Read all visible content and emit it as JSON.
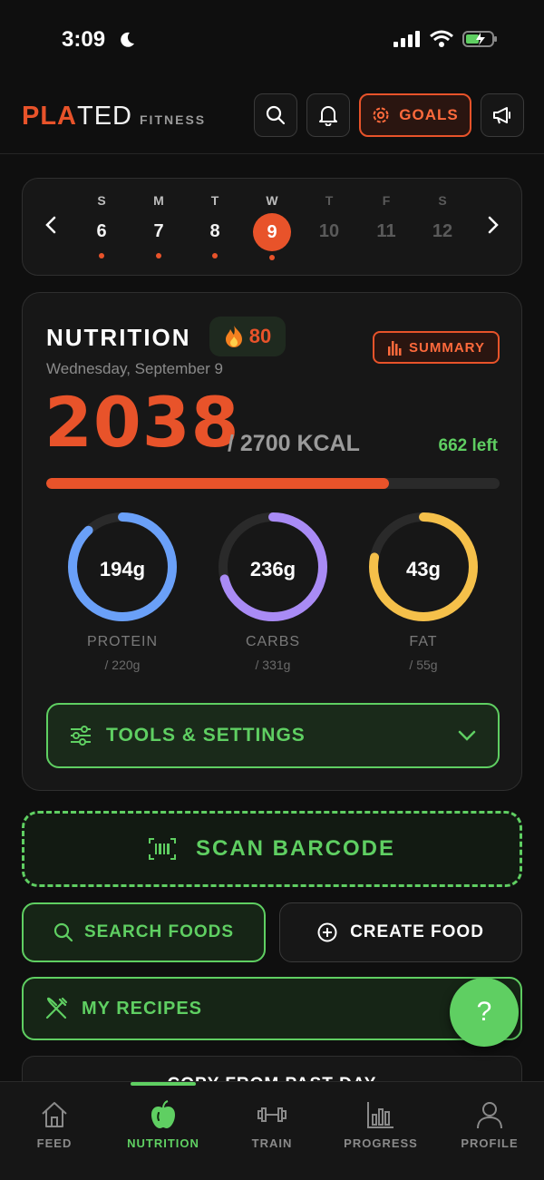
{
  "status_bar": {
    "time": "3:09"
  },
  "header": {
    "logo_part1": "PLA",
    "logo_part2": "TED",
    "logo_sub": "FITNESS",
    "goals_label": "GOALS"
  },
  "calendar": {
    "days": [
      {
        "letter": "S",
        "num": "6"
      },
      {
        "letter": "M",
        "num": "7"
      },
      {
        "letter": "T",
        "num": "8"
      },
      {
        "letter": "W",
        "num": "9"
      },
      {
        "letter": "T",
        "num": "10"
      },
      {
        "letter": "F",
        "num": "11"
      },
      {
        "letter": "S",
        "num": "12"
      }
    ],
    "selected": "9"
  },
  "nutrition": {
    "title": "NUTRITION",
    "streak": "80",
    "summary_label": "SUMMARY",
    "date": "Wednesday, September 9",
    "kcal_consumed": "2038",
    "kcal_goal": "/ 2700 KCAL",
    "kcal_left": "662 left",
    "progress_fraction": 0.755,
    "macros": [
      {
        "label": "PROTEIN",
        "value": "194g",
        "goal": "/ 220g",
        "fraction": 0.88,
        "color": "#6aa0f8"
      },
      {
        "label": "CARBS",
        "value": "236g",
        "goal": "/ 331g",
        "fraction": 0.71,
        "color": "#a98bf5"
      },
      {
        "label": "FAT",
        "value": "43g",
        "goal": "/ 55g",
        "fraction": 0.78,
        "color": "#f5c04a"
      }
    ],
    "tools_label": "TOOLS & SETTINGS"
  },
  "actions": {
    "scan_label": "SCAN BARCODE",
    "search_label": "SEARCH FOODS",
    "create_label": "CREATE FOOD",
    "recipes_label": "MY RECIPES",
    "copy_label": "COPY FROM PAST DAY",
    "help_label": "?"
  },
  "tabs": [
    {
      "label": "FEED",
      "icon": "home-icon"
    },
    {
      "label": "NUTRITION",
      "icon": "apple-icon"
    },
    {
      "label": "TRAIN",
      "icon": "dumbbell-icon"
    },
    {
      "label": "PROGRESS",
      "icon": "bar-chart-icon"
    },
    {
      "label": "PROFILE",
      "icon": "person-icon"
    }
  ],
  "colors": {
    "accent": "#e8532a",
    "green": "#5fcf62"
  }
}
